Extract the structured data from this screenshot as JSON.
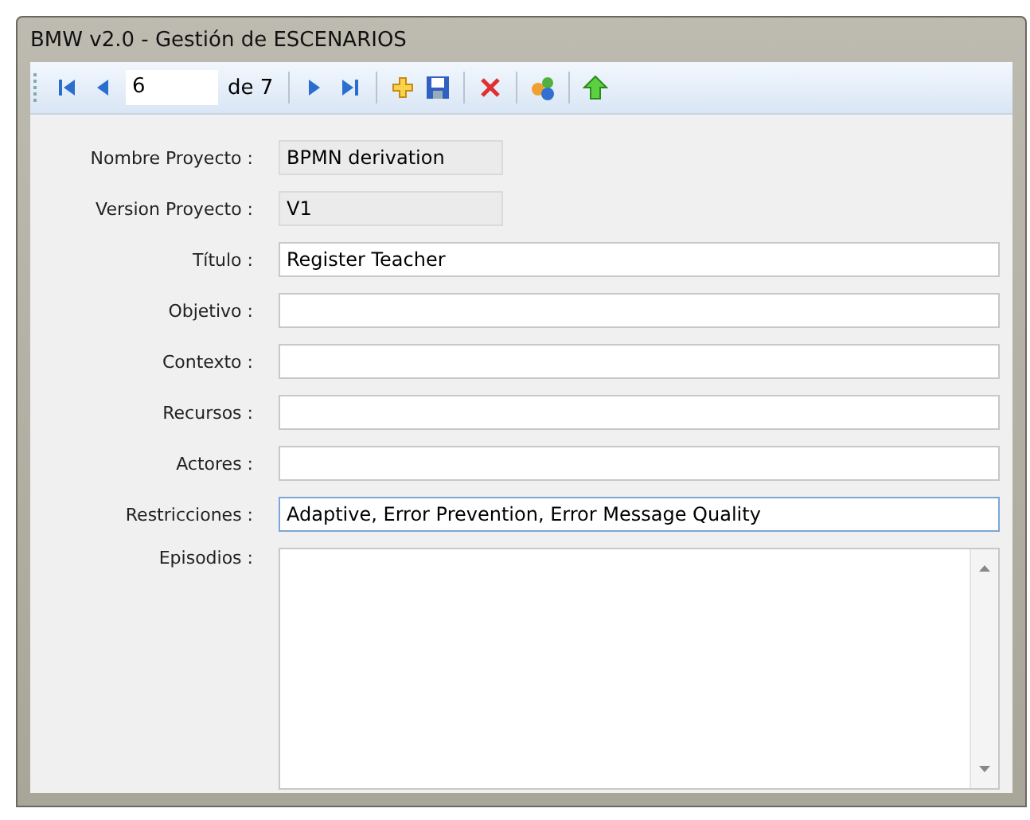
{
  "window": {
    "title": "BMW v2.0 - Gestión de ESCENARIOS"
  },
  "toolbar": [
    {
      "kind": "first"
    },
    {
      "kind": "prev"
    },
    {
      "kind": "field",
      "value": "6"
    },
    {
      "kind": "text",
      "text": "de 7"
    },
    {
      "kind": "sep"
    },
    {
      "kind": "next"
    },
    {
      "kind": "last"
    },
    {
      "kind": "sep"
    },
    {
      "kind": "add"
    },
    {
      "kind": "save"
    },
    {
      "kind": "sep"
    },
    {
      "kind": "delete"
    },
    {
      "kind": "sep"
    },
    {
      "kind": "shapes"
    },
    {
      "kind": "sep"
    },
    {
      "kind": "up"
    }
  ],
  "fields": [
    {
      "label": "Nombre Proyecto :",
      "value": "BPMN derivation",
      "readonly": true,
      "focused": false
    },
    {
      "label": "Version Proyecto :",
      "value": "V1",
      "readonly": true,
      "focused": false
    },
    {
      "label": "Título  :",
      "value": "Register Teacher",
      "readonly": false,
      "focused": false
    },
    {
      "label": "Objetivo  :",
      "readonly": false,
      "focused": false
    },
    {
      "label": "Contexto :",
      "readonly": false,
      "focused": false
    },
    {
      "label": "Recursos  :",
      "readonly": false,
      "focused": false
    },
    {
      "label": "Actores :",
      "readonly": false,
      "focused": false
    },
    {
      "label": "Restricciones :",
      "value": "Adaptive, Error Prevention, Error Message Quality",
      "readonly": false,
      "focused": true
    }
  ],
  "episodes": {
    "label": "Episodios :"
  }
}
